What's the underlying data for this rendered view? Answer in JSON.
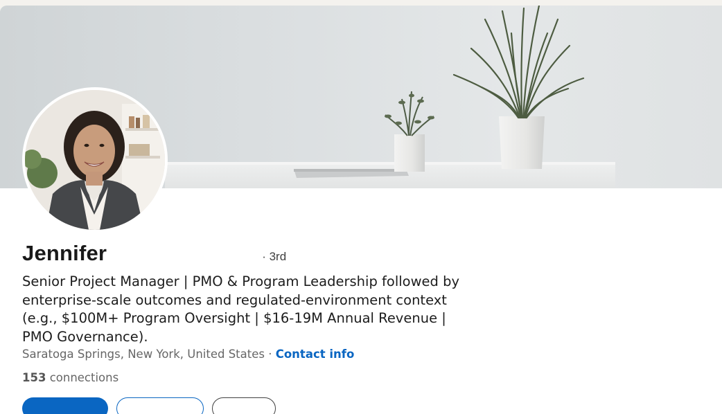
{
  "profile": {
    "name": "Jennifer",
    "degree": "· 3rd",
    "headline": "Senior Project Manager | PMO & Program Leadership followed by enterprise-scale outcomes and regulated-environment context (e.g., $100M+ Program Oversight | $16-19M Annual Revenue | PMO Governance).",
    "location": "Saratoga Springs, New York, United States",
    "location_separator": " · ",
    "contact_info_label": "Contact info",
    "connections_count": "153",
    "connections_label": " connections"
  },
  "actions": {
    "primary_label": "",
    "secondary_label": "",
    "tertiary_label": ""
  },
  "colors": {
    "link": "#0a66c2",
    "primary_button": "#0a66c2",
    "text": "#191919",
    "muted_text": "#666666"
  }
}
